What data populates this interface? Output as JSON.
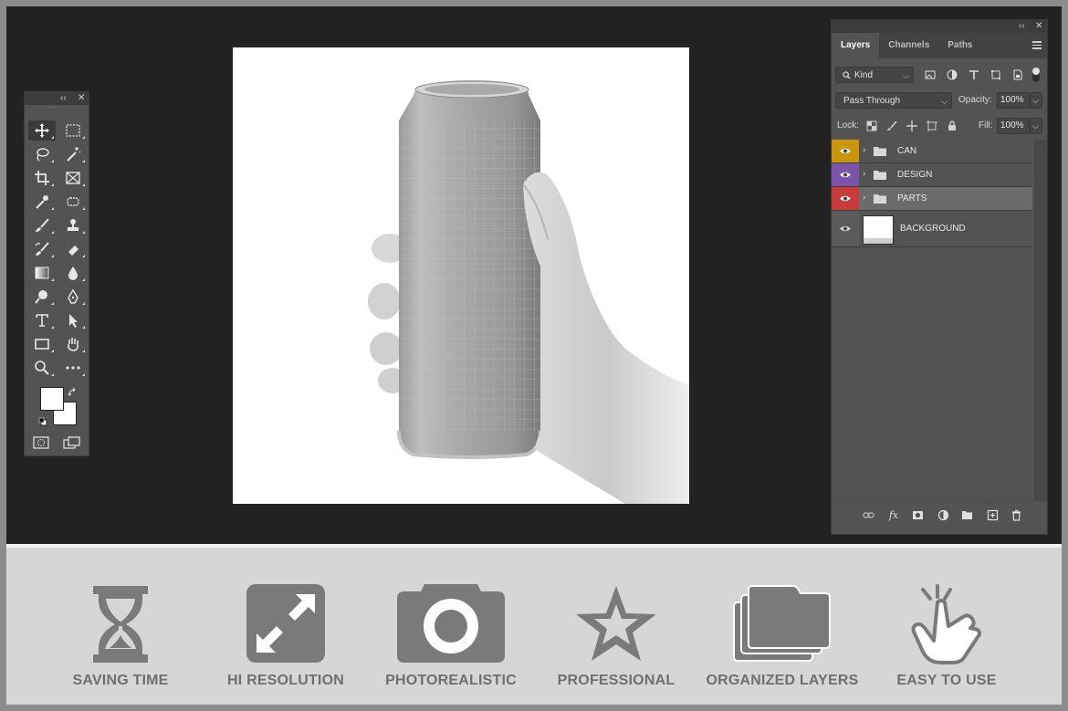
{
  "colors": {
    "workspace": "#222222",
    "panel": "#535353",
    "panel_dark": "#3c3c3c",
    "feature_bg": "#d6d6d6",
    "feature_icon": "#7a7a7a",
    "feature_label": "#6f6f6f",
    "layer_can": "#c9960e",
    "layer_design": "#7b53a8",
    "layer_parts": "#c73b3b"
  },
  "toolbar": {
    "collapse": "‹‹",
    "close": "✕",
    "tools": [
      "move-tool-icon",
      "marquee-tool-icon",
      "lasso-tool-icon",
      "magic-wand-icon",
      "crop-tool-icon",
      "frame-tool-icon",
      "eyedropper-icon",
      "healing-brush-icon",
      "brush-tool-icon",
      "clone-stamp-icon",
      "history-brush-icon",
      "eraser-icon",
      "gradient-tool-icon",
      "blur-tool-icon",
      "dodge-tool-icon",
      "pen-tool-icon",
      "type-tool-icon",
      "path-selection-icon",
      "rectangle-tool-icon",
      "hand-tool-icon",
      "zoom-tool-icon",
      "more-tools-icon"
    ]
  },
  "panel": {
    "collapse": "‹‹",
    "close": "✕",
    "tabs": [
      "Layers",
      "Channels",
      "Paths"
    ],
    "filter_kind": "Kind",
    "blend_mode": "Pass Through",
    "opacity_label": "Opacity:",
    "opacity_value": "100%",
    "lock_label": "Lock:",
    "fill_label": "Fill:",
    "fill_value": "100%",
    "layers": [
      {
        "name": "CAN",
        "color": "#c9960e"
      },
      {
        "name": "DESIGN",
        "color": "#7b53a8"
      },
      {
        "name": "PARTS",
        "color": "#c73b3b"
      },
      {
        "name": "BACKGROUND",
        "color": ""
      }
    ],
    "fx_label": "fx"
  },
  "features": [
    {
      "label": "SAVING TIME",
      "icon": "hourglass-icon"
    },
    {
      "label": "HI RESOLUTION",
      "icon": "expand-arrows-icon"
    },
    {
      "label": "PHOTOREALISTIC",
      "icon": "camera-icon"
    },
    {
      "label": "PROFESSIONAL",
      "icon": "star-icon"
    },
    {
      "label": "ORGANIZED LAYERS",
      "icon": "stacked-folders-icon"
    },
    {
      "label": "EASY TO USE",
      "icon": "tap-hand-icon"
    }
  ]
}
